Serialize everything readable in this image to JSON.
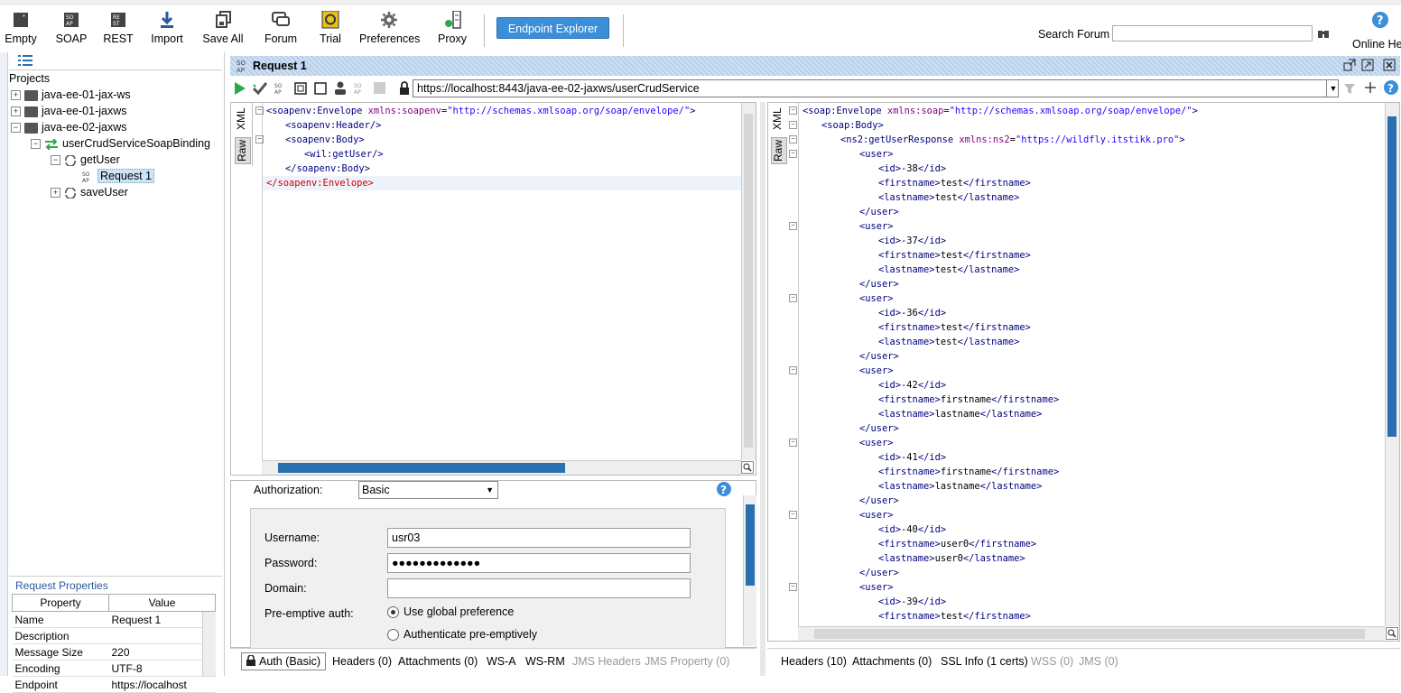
{
  "toolbar": {
    "buttons": [
      {
        "label": "Empty",
        "icon": "empty-project-icon"
      },
      {
        "label": "SOAP",
        "icon": "soap-icon"
      },
      {
        "label": "REST",
        "icon": "rest-icon"
      },
      {
        "label": "Import",
        "icon": "import-icon"
      },
      {
        "label": "Save All",
        "icon": "save-all-icon"
      },
      {
        "label": "Forum",
        "icon": "forum-icon"
      },
      {
        "label": "Trial",
        "icon": "trial-icon"
      },
      {
        "label": "Preferences",
        "icon": "gear-icon"
      },
      {
        "label": "Proxy",
        "icon": "proxy-icon"
      }
    ],
    "endpoint_explorer": "Endpoint Explorer",
    "search_label": "Search Forum",
    "search_value": "",
    "online_help": "Online He"
  },
  "navigator": {
    "title": "Projects",
    "items": [
      {
        "label": "java-ee-01-jax-ws"
      },
      {
        "label": "java-ee-01-jaxws"
      },
      {
        "label": "java-ee-02-jaxws"
      },
      {
        "label": "userCrudServiceSoapBinding"
      },
      {
        "label": "getUser"
      },
      {
        "label": "Request 1"
      },
      {
        "label": "saveUser"
      }
    ]
  },
  "request_properties": {
    "title": "Request Properties",
    "headers": [
      "Property",
      "Value"
    ],
    "rows": [
      [
        "Name",
        "Request 1"
      ],
      [
        "Description",
        ""
      ],
      [
        "Message Size",
        "220"
      ],
      [
        "Encoding",
        "UTF-8"
      ],
      [
        "Endpoint",
        "https://localhost"
      ]
    ]
  },
  "request": {
    "title": "Request 1",
    "url": "https://localhost:8443/java-ee-02-jaxws/userCrudService",
    "side_tabs": [
      "XML",
      "Raw"
    ],
    "xml_lines": [
      {
        "indent": 0,
        "open": "<soapenv:Envelope ",
        "attr": "xmlns:soapenv",
        "val": "\"http://schemas.xmlsoap.org/soap/envelope/\"",
        "close": ">"
      },
      {
        "indent": 1,
        "open": "<soapenv:Header/>"
      },
      {
        "indent": 1,
        "open": "<soapenv:Body>"
      },
      {
        "indent": 2,
        "open": "<wil:getUser/>"
      },
      {
        "indent": 1,
        "open": "</soapenv:Body>"
      },
      {
        "indent": 0,
        "open": "</soapenv:Envelope>"
      }
    ],
    "auth": {
      "authorization_label": "Authorization:",
      "authorization_value": "Basic",
      "username_label": "Username:",
      "username_value": "usr03",
      "password_label": "Password:",
      "password_value": "●●●●●●●●●●●●●",
      "domain_label": "Domain:",
      "domain_value": "",
      "preemptive_label": "Pre-emptive auth:",
      "option_global": "Use global preference",
      "option_preemptive": "Authenticate pre-emptively"
    },
    "bottom_tabs": [
      "Auth (Basic)",
      "Headers (0)",
      "Attachments (0)",
      "WS-A",
      "WS-RM",
      "JMS Headers",
      "JMS Property (0)"
    ]
  },
  "response": {
    "side_tabs": [
      "XML",
      "Raw"
    ],
    "envelope_open": "<soap:Envelope ",
    "envelope_attr": "xmlns:soap",
    "envelope_val": "\"http://schemas.xmlsoap.org/soap/envelope/\"",
    "body_open": "<soap:Body>",
    "resp_open": "<ns2:getUserResponse ",
    "resp_attr": "xmlns:ns2",
    "resp_val": "\"https://wildfly.itstikk.pro\"",
    "users": [
      {
        "id": "-38",
        "firstname": "test",
        "lastname": "test"
      },
      {
        "id": "-37",
        "firstname": "test",
        "lastname": "test"
      },
      {
        "id": "-36",
        "firstname": "test",
        "lastname": "test"
      },
      {
        "id": "-42",
        "firstname": "firstname",
        "lastname": "lastname"
      },
      {
        "id": "-41",
        "firstname": "firstname",
        "lastname": "lastname"
      },
      {
        "id": "-40",
        "firstname": "user0",
        "lastname": "user0"
      },
      {
        "id": "-39",
        "firstname": "test",
        "lastname": ""
      }
    ],
    "bottom_tabs": [
      "Headers (10)",
      "Attachments (0)",
      "SSL Info (1 certs)",
      "WSS (0)",
      "JMS (0)"
    ]
  },
  "colors": {
    "accent": "#3b8fd9",
    "xml_tag": "#000080",
    "xml_attr": "#7f007f",
    "xml_value": "#2a00ff",
    "run_green": "#2ea84a"
  }
}
